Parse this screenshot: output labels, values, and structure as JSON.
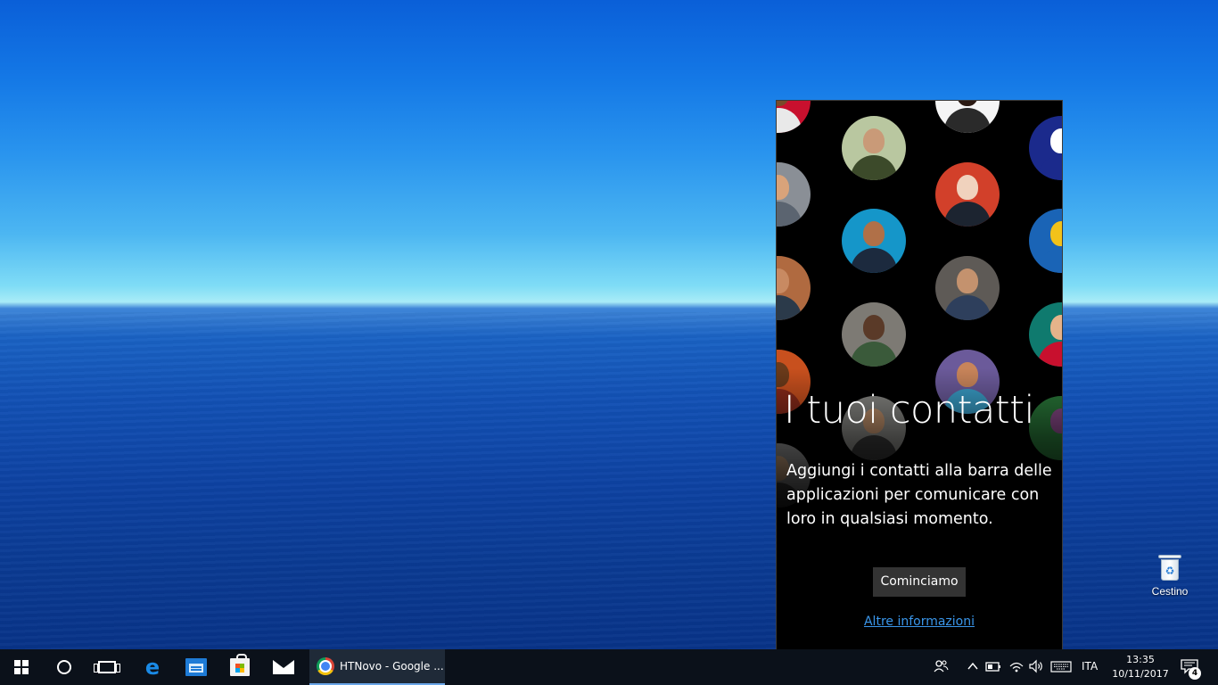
{
  "desktop": {
    "recycle_bin_label": "Cestino"
  },
  "people_flyout": {
    "title": "I tuoi contatti",
    "description": "Aggiungi i contatti alla barra delle applicazioni per comunicare con loro in qualsiasi momento.",
    "get_started_button": "Cominciamo",
    "learn_more_link": "Altre informazioni",
    "colors": {
      "background": "#000000",
      "button": "#333333",
      "link": "#3a96ea"
    }
  },
  "taskbar": {
    "start_icon": "windows-logo-icon",
    "search_icon": "cortana-icon",
    "task_view_icon": "task-view-icon",
    "pinned_apps": [
      {
        "name": "edge",
        "icon": "edge-icon"
      },
      {
        "name": "file-explorer",
        "icon": "file-explorer-icon"
      },
      {
        "name": "store",
        "icon": "store-icon"
      },
      {
        "name": "mail",
        "icon": "mail-icon"
      }
    ],
    "running_app": {
      "icon": "chrome-icon",
      "title": "HTNovo - Google ..."
    },
    "tray": {
      "people_icon": "people-icon",
      "chevron_icon": "chevron-up-icon",
      "battery_icon": "battery-icon",
      "network_icon": "wifi-icon",
      "volume_icon": "volume-icon",
      "keyboard_icon": "touch-keyboard-icon",
      "language": "ITA",
      "time": "13:35",
      "date": "10/11/2017",
      "notification_icon": "action-center-icon",
      "notification_count": "4"
    }
  }
}
